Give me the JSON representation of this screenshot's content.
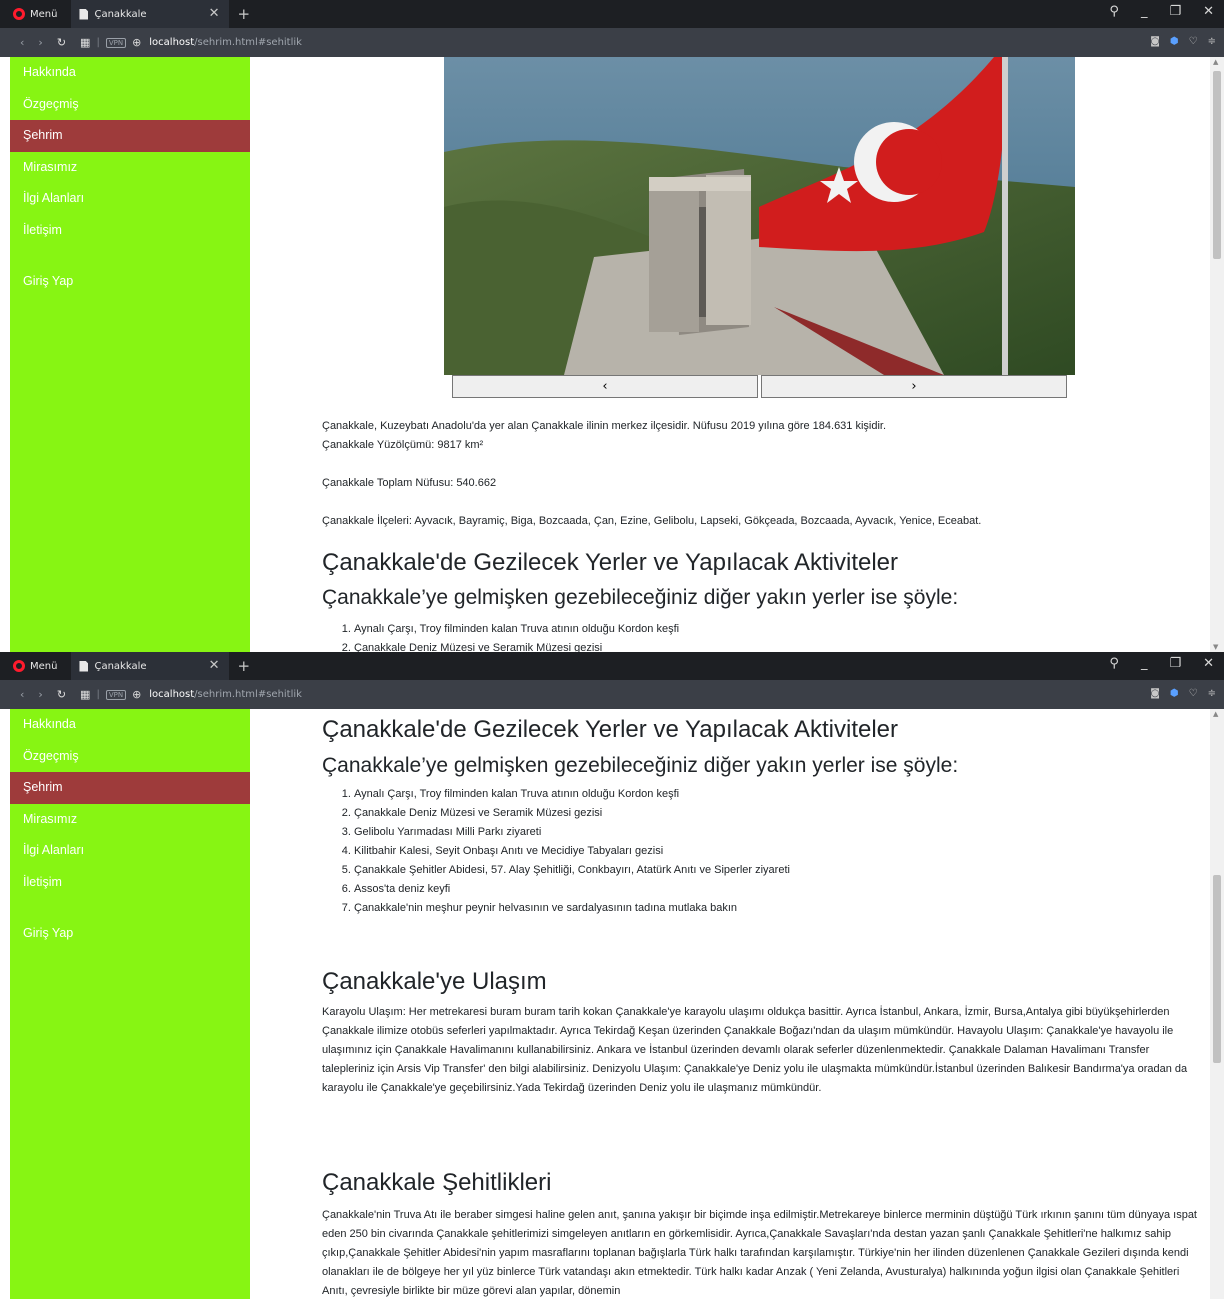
{
  "browser": {
    "menu_label": "Menü",
    "tab_title": "Çanakkale",
    "url_host": "localhost",
    "url_path": "/sehrim.html#sehitlik",
    "vpn_label": "VPN"
  },
  "sidebar": {
    "items": [
      {
        "label": "Hakkında"
      },
      {
        "label": "Özgeçmiş"
      },
      {
        "label": "Şehrim"
      },
      {
        "label": "Mirasımız"
      },
      {
        "label": "İlgi Alanları"
      },
      {
        "label": "İletişim"
      }
    ],
    "login_label": "Giriş Yap",
    "active_color": "#9e3b3b",
    "bg_color": "#87f513"
  },
  "carousel": {
    "prev_label": "‹",
    "next_label": "›"
  },
  "info": {
    "line1": "Çanakkale, Kuzeybatı Anadolu'da yer alan Çanakkale ilinin merkez ilçesidir. Nüfusu 2019 yılına göre 184.631 kişidir.",
    "line2": "Çanakkale Yüzölçümü: 9817 km²",
    "line3": "Çanakkale Toplam Nüfusu: 540.662",
    "line4": "Çanakkale İlçeleri: Ayvacık, Bayramiç, Biga, Bozcaada, Çan, Ezine, Gelibolu, Lapseki, Gökçeada, Bozcaada, Ayvacık, Yenice, Eceabat."
  },
  "places": {
    "heading": "Çanakkale'de Gezilecek Yerler ve Yapılacak Aktiviteler",
    "subheading": "Çanakkale’ye gelmişken gezebileceğiniz diğer yakın yerler ise şöyle:",
    "items": [
      "Aynalı Çarşı, Troy filminden kalan Truva atının olduğu Kordon keşfi",
      "Çanakkale Deniz Müzesi ve Seramik Müzesi gezisi",
      "Gelibolu Yarımadası Milli Parkı ziyareti",
      "Kilitbahir Kalesi, Seyit Onbaşı Anıtı ve Mecidiye Tabyaları gezisi",
      "Çanakkale Şehitler Abidesi, 57. Alay Şehitliği, Conkbayırı, Atatürk Anıtı ve Siperler ziyareti",
      "Assos'ta deniz keyfi",
      "Çanakkale'nin meşhur peynir helvasının ve sardalyasının tadına mutlaka bakın"
    ]
  },
  "transport": {
    "heading": "Çanakkale'ye Ulaşım",
    "text": "Karayolu Ulaşım: Her metrekaresi buram buram tarih kokan Çanakkale'ye karayolu ulaşımı oldukça basittir. Ayrıca İstanbul, Ankara, İzmir, Bursa,Antalya gibi büyükşehirlerden Çanakkale ilimize otobüs seferleri yapılmaktadır. Ayrıca Tekirdağ Keşan üzerinden Çanakkale Boğazı'ndan da ulaşım mümkündür. Havayolu Ulaşım: Çanakkale'ye havayolu ile ulaşımınız için Çanakkale Havalimanını kullanabilirsiniz. Ankara ve İstanbul üzerinden devamlı olarak seferler düzenlenmektedir. Çanakkale Dalaman Havalimanı Transfer talepleriniz için Arsis Vip Transfer' den bilgi alabilirsiniz. Denizyolu Ulaşım: Çanakkale'ye Deniz yolu ile ulaşmakta mümkündür.İstanbul üzerinden Balıkesir Bandırma'ya oradan da karayolu ile Çanakkale'ye geçebilirsiniz.Yada Tekirdağ üzerinden Deniz yolu ile ulaşmanız mümkündür."
  },
  "martyrs": {
    "heading": "Çanakkale Şehitlikleri",
    "text": "Çanakkale'nin Truva Atı ile beraber simgesi haline gelen anıt, şanına yakışır bir biçimde inşa edilmiştir.Metrekareye binlerce merminin düştüğü Türk ırkının şanını tüm dünyaya ıspat eden 250 bin civarında Çanakkale şehitlerimizi simgeleyen anıtların en görkemlisidir. Ayrıca,Çanakkale Savaşları'nda destan yazan şanlı Çanakkale Şehitleri'ne halkımız sahip çıkıp,Çanakkale Şehitler Abidesi'nin yapım masraflarını toplanan bağışlarla Türk halkı tarafından karşılamıştır. Türkiye'nin her ilinden düzenlenen Çanakkale Gezileri dışında kendi olanakları ile de bölgeye her yıl yüz binlerce Türk vatandaşı akın etmektedir. Türk halkı kadar Anzak ( Yeni Zelanda, Avusturalya) halkınında yoğun ilgisi olan Çanakkale Şehitleri Anıtı, çevresiyle birlikte bir müze görevi alan yapılar, dönemin"
  }
}
